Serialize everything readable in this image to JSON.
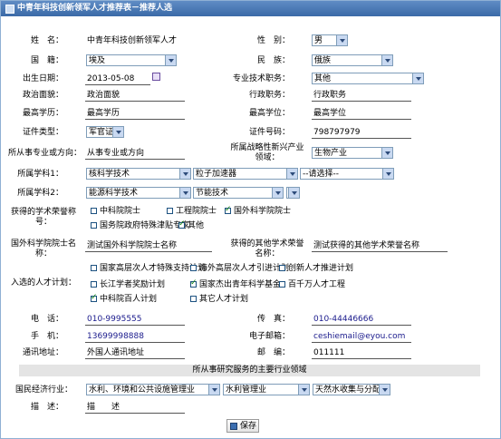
{
  "title": "中青年科技创新领军人才推荐表－推荐人选",
  "labels": {
    "name": "姓　名：",
    "gender": "性　别：",
    "nationality": "国　籍：",
    "ethnicity": "民　族：",
    "birth": "出生日期：",
    "prof_title": "专业技术职务：",
    "political": "政治面貌：",
    "admin_post": "行政职务：",
    "education": "最高学历：",
    "degree": "最高学位：",
    "id_type": "证件类型：",
    "id_no": "证件号码：",
    "field": "所从事专业或方向：",
    "strategic_line1": "所属战略性新兴产业",
    "strategic_line2": "领域：",
    "discipline1": "所属学科1：",
    "discipline2": "所属学科2：",
    "honor_line1": "获得的学术荣誉称",
    "honor_line2": "号：",
    "foreign_line1": "国外科学院院士名",
    "foreign_line2": "称：",
    "other_honor_line1": "获得的其他学术荣誉",
    "other_honor_line2": "名称：",
    "talent_plan": "入选的人才计划：",
    "phone": "电　话：",
    "fax": "传　真：",
    "mobile": "手　机：",
    "email": "电子邮箱：",
    "address": "通讯地址：",
    "postcode": "邮　编：",
    "industry": "国民经济行业：",
    "description": "描　述："
  },
  "values": {
    "name": "中青年科技创新领军人才",
    "gender": "男",
    "nationality": "埃及",
    "ethnicity": "俄族",
    "birth": "2013-05-08",
    "prof_title": "其他",
    "political": "政治面貌",
    "admin_post": "行政职务",
    "education": "最高学历",
    "degree": "最高学位",
    "id_type": "军官证",
    "id_no": "798797979",
    "field": "从事专业或方向",
    "strategic": "生物产业",
    "d1a": "核科学技术",
    "d1b": "粒子加速器",
    "d1c": "--请选择--",
    "d2a": "能源科学技术",
    "d2b": "节能技术",
    "d2c": "",
    "foreign": "测试国外科学院院士名称",
    "other_honor": "测试获得的其他学术荣誉名称",
    "phone": "010-9995555",
    "fax": "010-44446666",
    "mobile": "13699998888",
    "email": "ceshiemail@eyou.com",
    "address": "外国人通讯地址",
    "postcode": "011111",
    "ind1": "水利、环境和公共设施管理业",
    "ind2": "水利管理业",
    "ind3": "天然水收集与分配",
    "description": "描　　述"
  },
  "honors": [
    {
      "label": "中科院院士",
      "checked": false
    },
    {
      "label": "工程院院士",
      "checked": false
    },
    {
      "label": "国外科学院院士",
      "checked": true
    },
    {
      "label": "国务院政府特殊津贴专家",
      "checked": false
    },
    {
      "label": "其他",
      "checked": true
    }
  ],
  "plans": [
    {
      "label": "国家高层次人才特殊支持计划",
      "checked": false
    },
    {
      "label": "海外高层次人才引进计划",
      "checked": false
    },
    {
      "label": "创新人才推进计划",
      "checked": false
    },
    {
      "label": "长江学者奖励计划",
      "checked": false
    },
    {
      "label": "国家杰出青年科学基金",
      "checked": true
    },
    {
      "label": "百千万人才工程",
      "checked": false
    },
    {
      "label": "中科院百人计划",
      "checked": true
    },
    {
      "label": "其它人才计划",
      "checked": false
    }
  ],
  "section_band": "所从事研究服务的主要行业领域",
  "save_label": "保存"
}
